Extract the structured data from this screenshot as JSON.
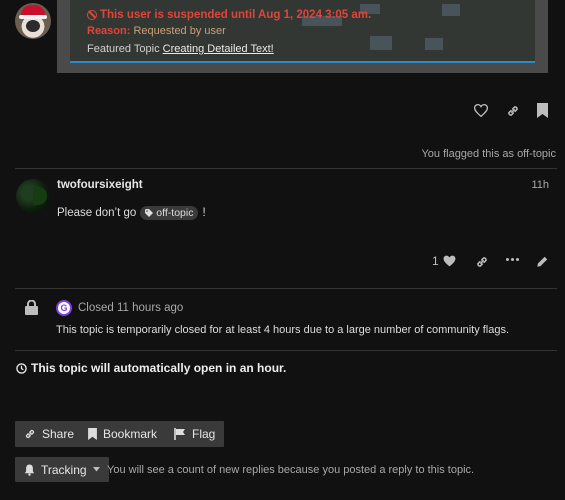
{
  "top_post": {
    "suspended_text": "This user is suspended until Aug 1, 2024 3:05 am.",
    "reason_label": "Reason:",
    "reason_value": "Requested by user",
    "featured_label": "Featured Topic",
    "featured_link": "Creating Detailed Text!"
  },
  "flag_note": "You flagged this as off-topic",
  "reply": {
    "username": "twofoursixeight",
    "time": "11h",
    "text_before": "Please don’t go",
    "tag": "off-topic",
    "text_after": "!",
    "like_count": "1"
  },
  "closed_notice": {
    "avatar_letter": "G",
    "status": "Closed 11 hours ago",
    "message": "This topic is temporarily closed for at least 4 hours due to a large number of community flags."
  },
  "auto_open": "This topic will automatically open in an hour.",
  "buttons": {
    "share": "Share",
    "bookmark": "Bookmark",
    "flag": "Flag"
  },
  "tracking": {
    "label": "Tracking",
    "description": "You will see a count of new replies because you posted a reply to this topic."
  },
  "colors": {
    "background": "#111111",
    "error_red": "#e0453a",
    "accent_purple": "#7b3fe4"
  }
}
